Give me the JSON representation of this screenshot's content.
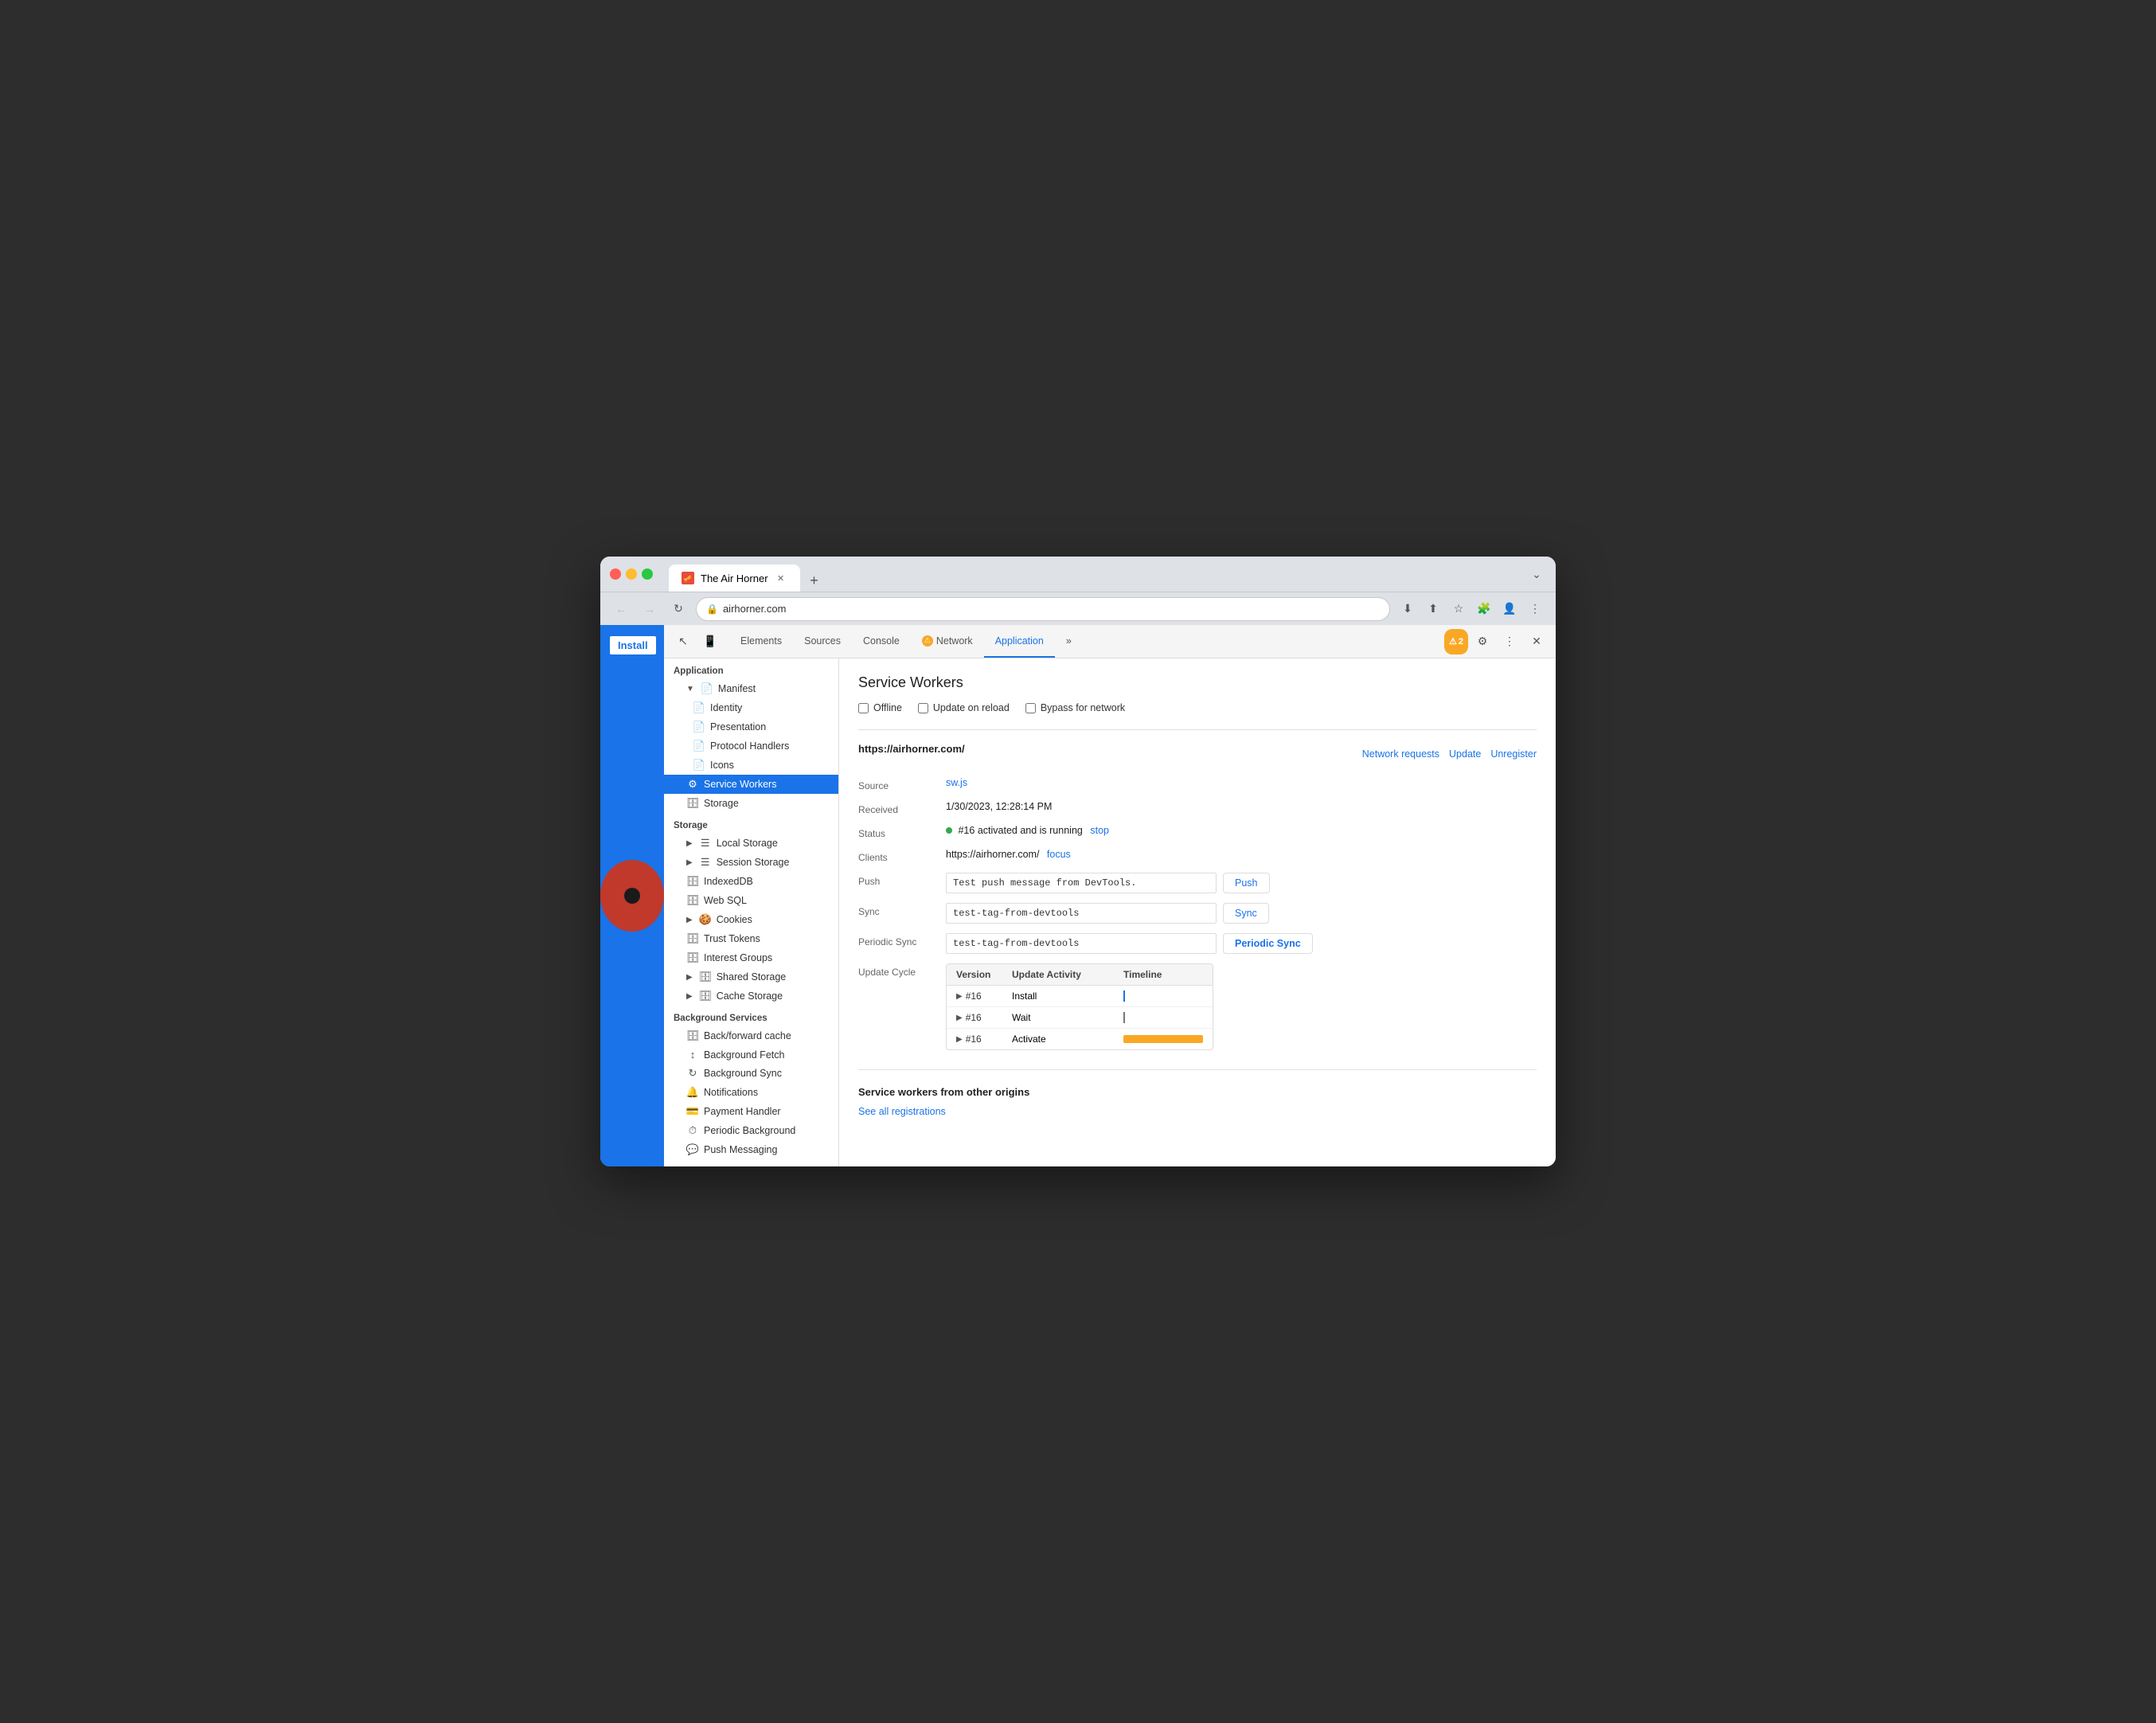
{
  "window": {
    "title": "The Air Horner",
    "url": "airhorner.com"
  },
  "chrome": {
    "tab_label": "The Air Horner",
    "new_tab_symbol": "+",
    "back_btn": "←",
    "forward_btn": "→",
    "reload_btn": "↻",
    "install_btn": "Install"
  },
  "devtools": {
    "tabs": [
      {
        "label": "Elements",
        "active": false,
        "warn": false
      },
      {
        "label": "Sources",
        "active": false,
        "warn": false
      },
      {
        "label": "Console",
        "active": false,
        "warn": false
      },
      {
        "label": "Network",
        "active": false,
        "warn": true
      },
      {
        "label": "Application",
        "active": true,
        "warn": false
      }
    ],
    "more_tabs_btn": "»",
    "warn_count": "2",
    "settings_icon": "⚙",
    "more_icon": "⋮",
    "close_icon": "✕"
  },
  "sidebar": {
    "application_label": "Application",
    "manifest_label": "Manifest",
    "identity_label": "Identity",
    "presentation_label": "Presentation",
    "protocol_handlers_label": "Protocol Handlers",
    "icons_label": "Icons",
    "service_workers_label": "Service Workers",
    "storage_section_label": "Storage",
    "storage_item_label": "Storage",
    "local_storage_label": "Local Storage",
    "session_storage_label": "Session Storage",
    "indexeddb_label": "IndexedDB",
    "web_sql_label": "Web SQL",
    "cookies_label": "Cookies",
    "trust_tokens_label": "Trust Tokens",
    "interest_groups_label": "Interest Groups",
    "shared_storage_label": "Shared Storage",
    "cache_storage_label": "Cache Storage",
    "background_services_label": "Background Services",
    "back_forward_cache_label": "Back/forward cache",
    "background_fetch_label": "Background Fetch",
    "background_sync_label": "Background Sync",
    "notifications_label": "Notifications",
    "payment_handler_label": "Payment Handler",
    "periodic_background_label": "Periodic Background",
    "push_messaging_label": "Push Messaging"
  },
  "service_workers": {
    "title": "Service Workers",
    "offline_label": "Offline",
    "update_on_reload_label": "Update on reload",
    "bypass_for_network_label": "Bypass for network",
    "origin": "https://airhorner.com/",
    "network_requests_label": "Network requests",
    "update_label": "Update",
    "unregister_label": "Unregister",
    "source_label": "Source",
    "source_file": "sw.js",
    "received_label": "Received",
    "received_value": "1/30/2023, 12:28:14 PM",
    "status_label": "Status",
    "status_text": "#16 activated and is running",
    "stop_label": "stop",
    "clients_label": "Clients",
    "clients_url": "https://airhorner.com/",
    "focus_label": "focus",
    "push_label": "Push",
    "push_value": "Test push message from DevTools.",
    "push_btn": "Push",
    "sync_label": "Sync",
    "sync_value": "test-tag-from-devtools",
    "sync_btn": "Sync",
    "periodic_sync_label": "Periodic Sync",
    "periodic_sync_value": "test-tag-from-devtools",
    "periodic_sync_btn": "Periodic Sync",
    "update_cycle_label": "Update Cycle",
    "update_cycle": {
      "headers": [
        "Version",
        "Update Activity",
        "Timeline"
      ],
      "rows": [
        {
          "version": "#16",
          "activity": "Install",
          "timeline_type": "dot"
        },
        {
          "version": "#16",
          "activity": "Wait",
          "timeline_type": "dot"
        },
        {
          "version": "#16",
          "activity": "Activate",
          "timeline_type": "bar"
        }
      ]
    },
    "other_origins_title": "Service workers from other origins",
    "see_all_label": "See all registrations"
  }
}
